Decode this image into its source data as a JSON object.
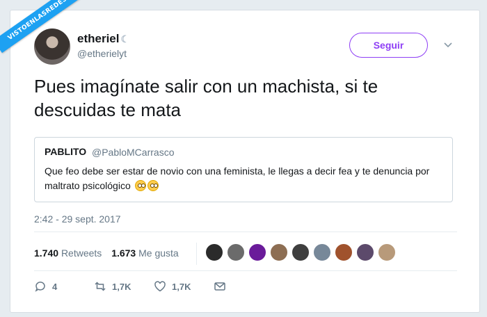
{
  "watermark": "VISTOENLASREDES",
  "tweet": {
    "display_name": "etheriel",
    "handle": "@etherielyt",
    "follow_label": "Seguir",
    "text": "Pues imagínate salir con un machista, si te descuidas te mata",
    "quoted": {
      "display_name": "PABLITO",
      "handle": "@PabloMCarrasco",
      "text": "Que feo debe ser estar de novio con una feminista, le llegas a decir fea y te denuncia por maltrato psicológico"
    },
    "timestamp": "2:42 - 29 sept. 2017",
    "stats": {
      "retweets_count": "1.740",
      "retweets_label": "Retweets",
      "likes_count": "1.673",
      "likes_label": "Me gusta"
    },
    "actions": {
      "reply_count": "4",
      "retweet_count": "1,7K",
      "like_count": "1,7K"
    }
  },
  "colors": {
    "accent": "#8e3ef5",
    "banner": "#1da1f2",
    "secondary_text": "#657786"
  }
}
